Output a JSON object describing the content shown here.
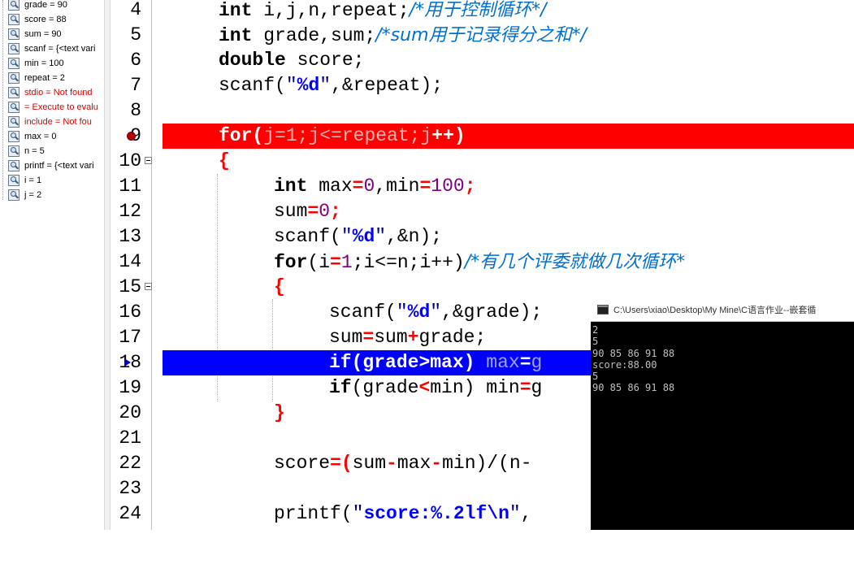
{
  "watch": {
    "items": [
      {
        "label": "grade = 90",
        "error": false
      },
      {
        "label": "score = 88",
        "error": false
      },
      {
        "label": "sum = 90",
        "error": false
      },
      {
        "label": "scanf = {<text vari",
        "error": false
      },
      {
        "label": "min = 100",
        "error": false
      },
      {
        "label": "repeat = 2",
        "error": false
      },
      {
        "label": "stdio = Not found",
        "error": true
      },
      {
        "label": " = Execute to evalu",
        "error": true
      },
      {
        "label": "include = Not fou",
        "error": true
      },
      {
        "label": "max = 0",
        "error": false
      },
      {
        "label": "n = 5",
        "error": false
      },
      {
        "label": "printf = {<text vari",
        "error": false
      },
      {
        "label": "i = 1",
        "error": false
      },
      {
        "label": "j = 2",
        "error": false
      }
    ],
    "icon": "watch-magnifier-icon"
  },
  "editor": {
    "line_numbers": [
      "4",
      "5",
      "6",
      "7",
      "8",
      "9",
      "10",
      "11",
      "12",
      "13",
      "14",
      "15",
      "16",
      "17",
      "18",
      "19",
      "20",
      "21",
      "22",
      "23",
      "24"
    ],
    "breakpoint_line": "9",
    "current_line": "18",
    "colors": {
      "breakpoint": "#ff0000",
      "current": "#0000ff",
      "keyword": "#000000",
      "operator": "#ff0000",
      "number": "#800080",
      "comment": "#0070d0"
    },
    "code": {
      "l4": {
        "kw": "int",
        "rest": " i,j,n,repeat;",
        "comment": "/*用于控制循环*/"
      },
      "l5": {
        "kw": "int",
        "rest": " grade,sum;",
        "comment": "/*sum用于记录得分之和*/"
      },
      "l6": {
        "kw": "double",
        "rest": " score;"
      },
      "l7": {
        "a": "scanf(",
        "s1": "\"",
        "f": "%d",
        "s2": "\"",
        "b": ",&repeat);"
      },
      "l9": {
        "kw": "for",
        "a": "(",
        "b": "j=1;j<=repeat;j",
        "c": "++)"
      },
      "l10": {
        "a": "{"
      },
      "l11": {
        "kw": "int",
        "a": " max",
        "b": "=",
        "c": "0",
        "d": ",min",
        "e": "=",
        "f": "100",
        "g": ";"
      },
      "l12": {
        "a": "sum",
        "b": "=",
        "c": "0",
        "d": ";"
      },
      "l13": {
        "a": "scanf(",
        "s1": "\"",
        "f": "%d",
        "s2": "\"",
        "b": ",&n);"
      },
      "l14": {
        "kw": "for",
        "a": "(i",
        "b": "=",
        "c": "1",
        "d": ";i<=n;i++)",
        "comment": "/*有几个评委就做几次循环*"
      },
      "l15": {
        "a": "{"
      },
      "l16": {
        "a": "scanf(",
        "s1": "\"",
        "f": "%d",
        "s2": "\"",
        "b": ",&grade);"
      },
      "l17": {
        "a": "sum",
        "b": "=",
        "c": "sum",
        "d": "+",
        "e": "grade;"
      },
      "l18": {
        "kw": "if",
        "a": "(grade",
        "b": ">",
        "c": "max)",
        "d": " max",
        "e": "=",
        "f": "g"
      },
      "l19": {
        "kw": "if",
        "a": "(grade",
        "b": "<",
        "c": "min)",
        "d": " min",
        "e": "=",
        "f": "g"
      },
      "l20": {
        "a": "}"
      },
      "l22": {
        "a": "score",
        "b": "=(",
        "c": "sum",
        "d": "-",
        "e": "max",
        "f": "-",
        "g": "min)/(n-"
      },
      "l24": {
        "a": "printf(",
        "s1": "\"",
        "f": "score:%.2lf\\n",
        "s2": "\"",
        "b": ","
      }
    }
  },
  "console": {
    "title": "C:\\Users\\xiao\\Desktop\\My Mine\\C语言作业--嵌套循",
    "lines": [
      "2",
      "5",
      "90 85 86 91 88",
      "score:88.00",
      "5",
      "90 85 86 91 88"
    ],
    "icon": "console-window-icon"
  }
}
